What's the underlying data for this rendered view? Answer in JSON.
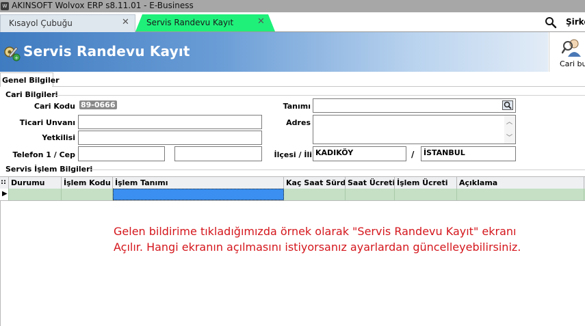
{
  "window": {
    "title": "AKINSOFT Wolvox ERP s8.11.01 - E-Business",
    "app_icon": "W"
  },
  "tabs": [
    {
      "label": "Kısayol Çubuğu",
      "active": false
    },
    {
      "label": "Servis Randevu Kayıt",
      "active": true
    }
  ],
  "search": {
    "label": "Şirket",
    "icon": "search-icon"
  },
  "header": {
    "title": "Servis Randevu Kayıt",
    "icon": "service-tools-icon"
  },
  "toolbar": {
    "cari_bul_label": "Cari bul",
    "cari_bul_icon": "person-search-icon"
  },
  "inner_tab": {
    "label": "Genel Bilgiler"
  },
  "cari_bilgileri": {
    "section_title": "Cari Bilgileri",
    "cari_kodu_label": "Cari Kodu",
    "cari_kodu_value": "89-0666",
    "ticari_unvani_label": "Ticari Unvanı",
    "ticari_unvani_value": "",
    "yetkilisi_label": "Yetkilisi",
    "yetkilisi_value": "",
    "telefon_label": "Telefon 1 / Cep",
    "telefon1_value": "",
    "cep_value": "",
    "tanimi_label": "Tanımı",
    "tanimi_value": "",
    "adres_label": "Adres",
    "adres_value": "",
    "ilcesi_label": "İlçesi / İli",
    "ilce_value": "KADIKÖY",
    "separator": "/",
    "il_value": "İSTANBUL"
  },
  "servis": {
    "section_title": "Servis İşlem Bilgileri",
    "columns": [
      "Durumu",
      "İşlem Kodu",
      "İşlem Tanımı",
      "Kaç Saat Sürdü",
      "Saat Ücreti",
      "İşlem Ücreti",
      "Açıklama"
    ],
    "row_indicator": "▶",
    "header_indicator": "::"
  },
  "annotation": {
    "line1": "Gelen bildirime tıkladığımızda örnek olarak \"Servis Randevu Kayıt\" ekranı",
    "line2": "Açılır. Hangi ekranın açılmasını istiyorsanız ayarlardan güncelleyebilirsiniz."
  },
  "colors": {
    "active_tab": "#1ff07a",
    "banner": "#3f7bc0",
    "annotation": "#d4161c",
    "grid_row": "#c5e0c5",
    "selected_cell": "#3a8ff0"
  }
}
